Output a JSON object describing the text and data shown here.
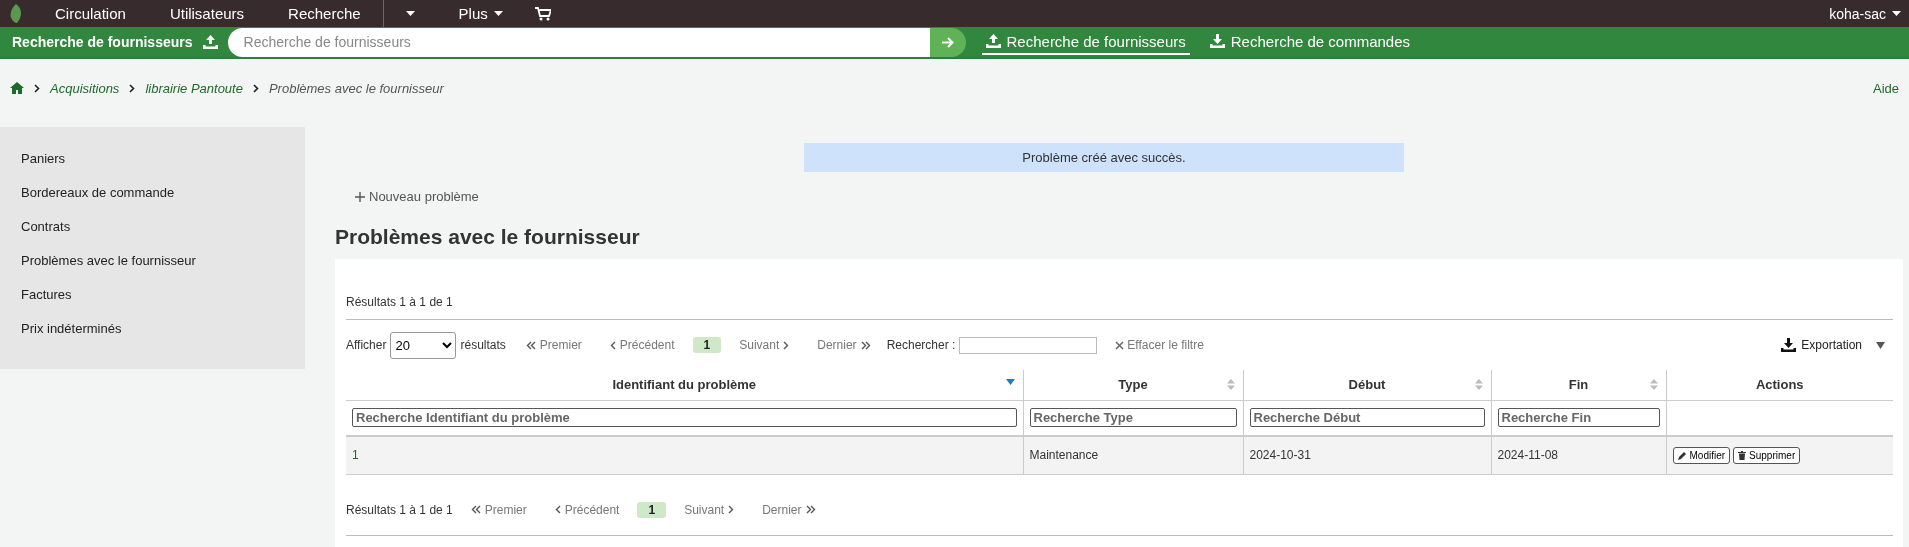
{
  "top_nav": {
    "items": [
      {
        "kind": "link",
        "label": "Circulation"
      },
      {
        "kind": "link",
        "label": "Utilisateurs"
      },
      {
        "kind": "link",
        "label": "Recherche"
      },
      {
        "kind": "caret"
      },
      {
        "kind": "menu",
        "label": "Plus"
      },
      {
        "kind": "cart"
      }
    ],
    "user": "koha-sac"
  },
  "search_bar": {
    "label": "Recherche de fournisseurs",
    "placeholder": "Recherche de fournisseurs",
    "tabs": [
      {
        "label": "Recherche de fournisseurs",
        "kind": "upload",
        "selected": true
      },
      {
        "label": "Recherche de commandes",
        "kind": "download",
        "selected": false
      }
    ]
  },
  "breadcrumb": {
    "items": [
      {
        "kind": "link",
        "label": "Acquisitions"
      },
      {
        "kind": "link",
        "label": "librairie Pantoute"
      },
      {
        "kind": "current",
        "label": "Problèmes avec le fournisseur"
      }
    ],
    "help": "Aide"
  },
  "sidebar": {
    "items": [
      "Paniers",
      "Bordereaux de commande",
      "Contrats",
      "Problèmes avec le fournisseur",
      "Factures",
      "Prix indéterminés"
    ]
  },
  "alert": "Problème créé avec succès.",
  "new_button": "Nouveau problème",
  "title": "Problèmes avec le fournisseur",
  "table": {
    "info_top": "Résultats 1 à 1 de 1",
    "show_label": "Afficher",
    "page_size": "20",
    "show_suffix": "résultats",
    "pager_top": [
      {
        "kind": "first",
        "label": "Premier",
        "disabled": true
      },
      {
        "kind": "prev",
        "label": "Précédent",
        "disabled": true
      },
      {
        "kind": "page",
        "label": "1",
        "selected": true
      },
      {
        "kind": "next",
        "label": "Suivant",
        "disabled": true
      },
      {
        "kind": "last",
        "label": "Dernier",
        "disabled": true
      }
    ],
    "search_label": "Rechercher :",
    "clear_filter": "Effacer le filtre",
    "export": "Exportation",
    "columns": [
      {
        "title": "Identifiant du problème",
        "sorted": true,
        "placeholder": "Recherche Identifiant du problème"
      },
      {
        "title": "Type",
        "sorted": false,
        "placeholder": "Recherche Type"
      },
      {
        "title": "Début",
        "sorted": false,
        "placeholder": "Recherche Début"
      },
      {
        "title": "Fin",
        "sorted": false,
        "placeholder": "Recherche Fin"
      },
      {
        "title": "Actions"
      }
    ],
    "rows": [
      {
        "cells": [
          "1",
          "Maintenance",
          "2024-10-31",
          "2024-11-08"
        ],
        "actions": [
          {
            "kind": "edit",
            "label": "Modifier"
          },
          {
            "kind": "delete",
            "label": "Supprimer"
          }
        ]
      }
    ],
    "info_bottom": "Résultats 1 à 1 de 1",
    "pager_bottom": [
      {
        "kind": "first",
        "label": "Premier",
        "disabled": true
      },
      {
        "kind": "prev",
        "label": "Précédent",
        "disabled": true
      },
      {
        "kind": "page",
        "label": "1",
        "selected": true
      },
      {
        "kind": "next",
        "label": "Suivant",
        "disabled": true
      },
      {
        "kind": "last",
        "label": "Dernier",
        "disabled": true
      }
    ]
  }
}
